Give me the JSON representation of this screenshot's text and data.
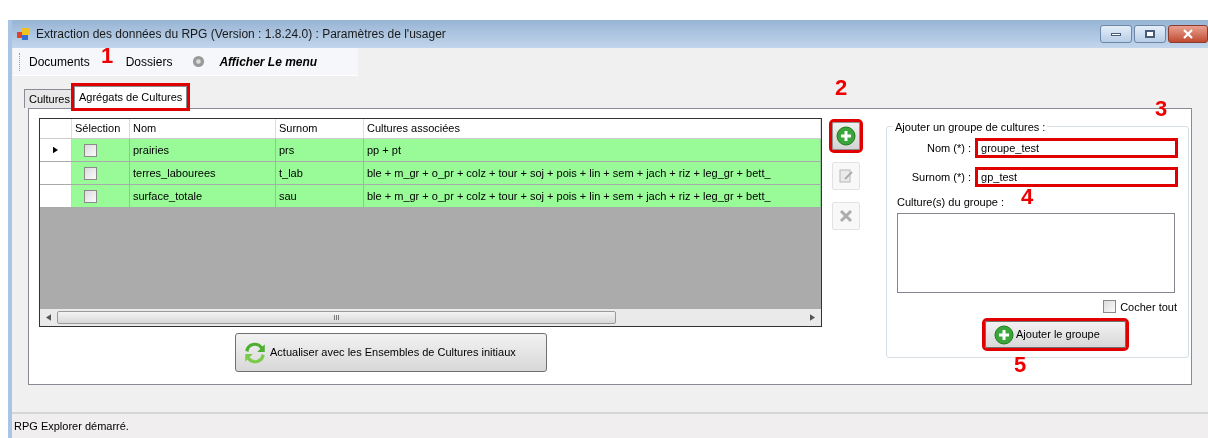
{
  "window": {
    "title": "Extraction des données du RPG (Version : 1.8.24.0) : Paramètres de l'usager"
  },
  "menu": [
    {
      "label": "Documents",
      "kind": "text"
    },
    {
      "label": "Dossiers",
      "kind": "text"
    },
    {
      "label": "Afficher Le menu",
      "kind": "gear"
    }
  ],
  "tabs": [
    {
      "label": "Cultures",
      "selected": false,
      "highlighted": false
    },
    {
      "label": "Agrégats de Cultures",
      "selected": true,
      "highlighted": true
    }
  ],
  "table": {
    "selection_header": "Sélection",
    "columns": [
      "Nom",
      "Surnom",
      "Cultures associées"
    ],
    "rows": [
      {
        "current": true,
        "checked": false,
        "cells": [
          "prairies",
          "prs",
          "pp + pt"
        ]
      },
      {
        "current": false,
        "checked": false,
        "cells": [
          "terres_labourees",
          "t_lab",
          "ble + m_gr + o_pr + colz + tour + soj + pois + lin + sem + jach + riz + leg_gr + bett_"
        ]
      },
      {
        "current": false,
        "checked": false,
        "cells": [
          "surface_totale",
          "sau",
          "ble + m_gr + o_pr + colz + tour + soj + pois + lin + sem + jach + riz + leg_gr + bett_"
        ]
      }
    ],
    "scroll_grip": "III"
  },
  "refresh_button": {
    "label": "Actualiser avec les Ensembles de Cultures initiaux"
  },
  "side_buttons": [
    {
      "kind": "add",
      "disabled": false,
      "highlighted": true
    },
    {
      "kind": "edit",
      "disabled": true,
      "highlighted": false
    },
    {
      "kind": "delete",
      "disabled": true,
      "highlighted": false
    }
  ],
  "group": {
    "title": "Ajouter un groupe de cultures :",
    "fields": [
      {
        "label": "Nom (*) :",
        "value": "groupe_test",
        "highlighted": true
      },
      {
        "label": "Surnom (*) :",
        "value": "gp_test",
        "highlighted": true
      }
    ],
    "list_label": "Culture(s) du groupe :",
    "check_all": {
      "label": "Cocher tout",
      "checked": false
    },
    "add_button": {
      "label": "Ajouter le groupe",
      "highlighted": true
    }
  },
  "status_bar": {
    "text": "RPG Explorer démarré."
  },
  "annotations": [
    "1",
    "2",
    "3",
    "4",
    "5"
  ]
}
